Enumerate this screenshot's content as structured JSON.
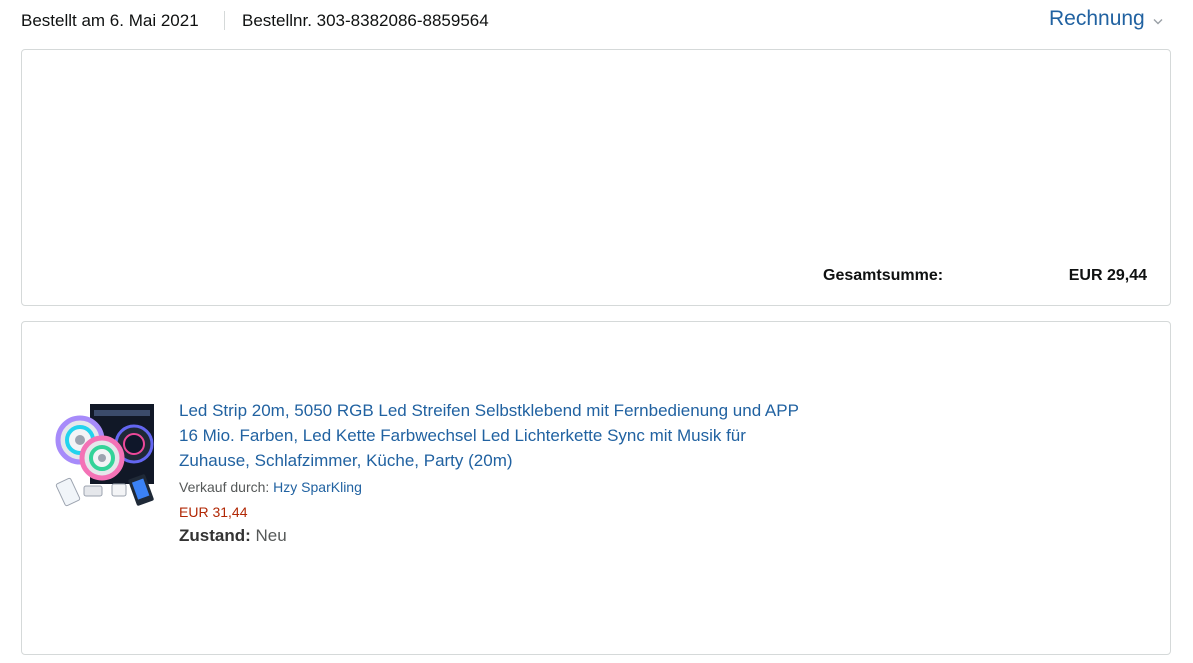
{
  "order": {
    "date_text": "Bestellt am 6. Mai 2021",
    "number_text": "Bestellnr. 303-8382086-8859564",
    "invoice_label": "Rechnung",
    "invoice_icon": "chevron-down-icon"
  },
  "summary": {
    "total_label": "Gesamtsumme:",
    "total_value": "EUR 29,44"
  },
  "item": {
    "title": "Led Strip 20m, 5050 RGB Led Streifen Selbstklebend mit Fernbedienung und APP 16 Mio. Farben, Led Kette Farbwechsel Led Lichterkette Sync mit Musik für Zuhause, Schlafzimmer, Küche, Party (20m)",
    "seller_prefix": "Verkauf durch:",
    "seller_name": "Hzy SparKling",
    "price": "EUR 31,44",
    "condition_label": "Zustand:",
    "condition_value": "Neu"
  },
  "colors": {
    "link": "#2162a1",
    "price": "#b12704",
    "border": "#d5d9d9"
  }
}
